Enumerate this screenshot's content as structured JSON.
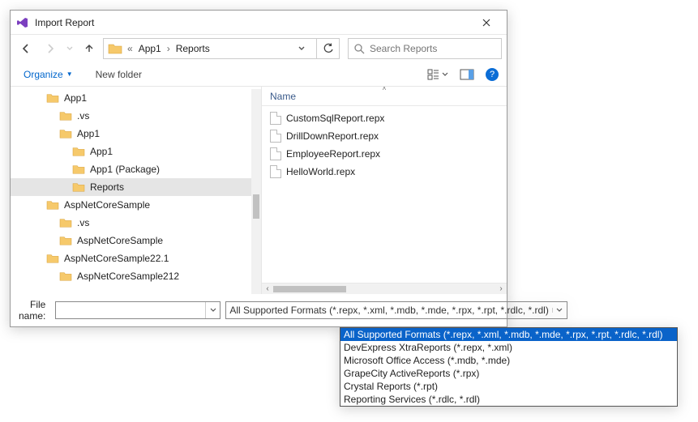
{
  "window": {
    "title": "Import Report"
  },
  "nav": {
    "crumb_prefix": "«",
    "crumb1": "App1",
    "crumb2": "Reports",
    "search_placeholder": "Search Reports"
  },
  "toolbar": {
    "organize": "Organize",
    "new_folder": "New folder"
  },
  "tree": {
    "items": [
      {
        "label": "App1",
        "indent": 0,
        "selected": false
      },
      {
        "label": ".vs",
        "indent": 1,
        "selected": false
      },
      {
        "label": "App1",
        "indent": 1,
        "selected": false
      },
      {
        "label": "App1",
        "indent": 2,
        "selected": false
      },
      {
        "label": "App1 (Package)",
        "indent": 2,
        "selected": false
      },
      {
        "label": "Reports",
        "indent": 2,
        "selected": true
      },
      {
        "label": "AspNetCoreSample",
        "indent": 0,
        "selected": false
      },
      {
        "label": ".vs",
        "indent": 1,
        "selected": false
      },
      {
        "label": "AspNetCoreSample",
        "indent": 1,
        "selected": false
      },
      {
        "label": "AspNetCoreSample22.1",
        "indent": 0,
        "selected": false
      },
      {
        "label": "AspNetCoreSample212",
        "indent": 1,
        "selected": false
      }
    ]
  },
  "files": {
    "column_name": "Name",
    "items": [
      "CustomSqlReport.repx",
      "DrillDownReport.repx",
      "EmployeeReport.repx",
      "HelloWorld.repx"
    ]
  },
  "bottom": {
    "file_name_label": "File name:",
    "file_name_value": "",
    "filter_selected": "All Supported Formats (*.repx, *.xml, *.mdb, *.mde, *.rpx, *.rpt, *.rdlc, *.rdl)"
  },
  "filter_options": [
    "All Supported Formats (*.repx, *.xml, *.mdb, *.mde, *.rpx, *.rpt, *.rdlc, *.rdl)",
    "DevExpress XtraReports (*.repx, *.xml)",
    "Microsoft Office Access (*.mdb, *.mde)",
    "GrapeCity ActiveReports (*.rpx)",
    "Crystal Reports (*.rpt)",
    "Reporting Services (*.rdlc, *.rdl)"
  ]
}
